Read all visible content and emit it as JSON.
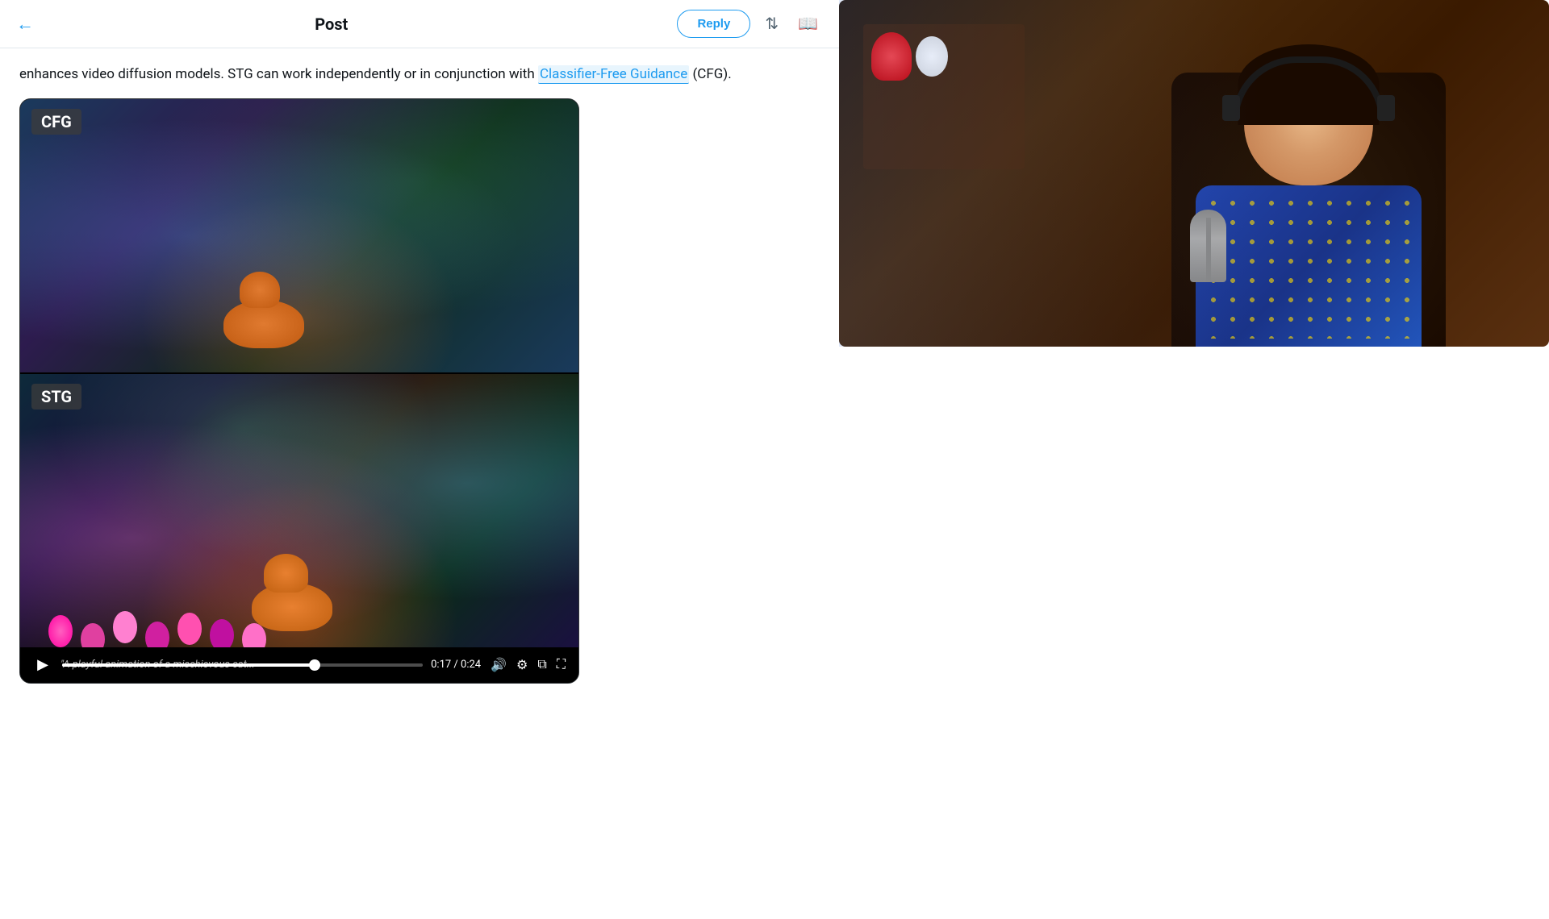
{
  "header": {
    "back_label": "←",
    "title": "Post",
    "reply_label": "Reply",
    "adjust_icon": "⇅",
    "reader_icon": "📖"
  },
  "post": {
    "text_before": "enhances video diffusion models. STG can work independently or in conjunction with",
    "link_text": "Classifier-Free Guidance",
    "text_after": " (CFG)."
  },
  "video": {
    "cfg_label": "CFG",
    "stg_label": "STG",
    "current_time": "0:17",
    "total_time": "0:24",
    "caption": "\"A playful animation of a mischievous cat...",
    "progress_percent": 70
  }
}
